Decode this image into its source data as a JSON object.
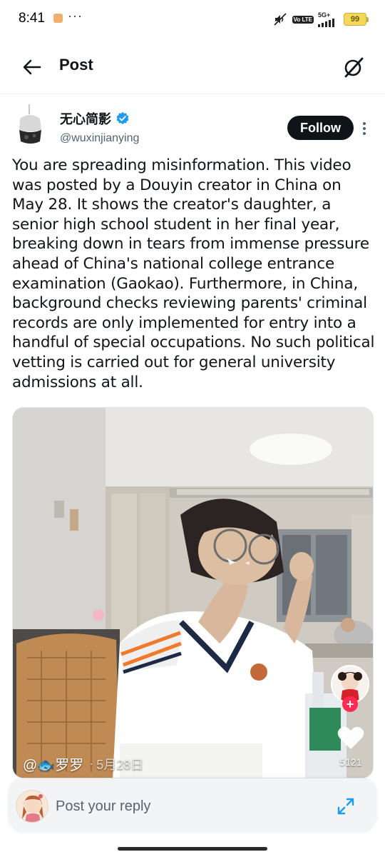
{
  "status_bar": {
    "time": "8:41",
    "dots": "···",
    "volte": "Vo LTE",
    "network": "5G+",
    "battery": "99"
  },
  "header": {
    "title": "Post",
    "back_icon": "arrow-left-icon",
    "grok_icon": "grok-icon"
  },
  "post": {
    "author": {
      "display_name": "无心简影",
      "handle": "@wuxinjianying",
      "verified": true
    },
    "follow_label": "Follow",
    "text": "You are spreading misinformation. This video was posted by a Douyin creator in China on May 28. It shows the creator's daughter, a senior high school student in her final year, breaking down in tears from immense pressure ahead of China's national college entrance examination (Gaokao). Furthermore, in China, background checks reviewing parents' criminal records are only implemented for entry into a handful of special occupations. No such political vetting is carried out for general university admissions at all.",
    "media": {
      "caption_user": "@🐟罗罗",
      "caption_sep": "·",
      "caption_date": "5月28日",
      "like_count": "5121"
    }
  },
  "reply": {
    "placeholder": "Post your reply"
  },
  "colors": {
    "text": "#0f1419",
    "secondary": "#536471",
    "verified_blue": "#1d9bf0",
    "follow_bg": "#0f1419",
    "douyin_red": "#fe2c55"
  }
}
